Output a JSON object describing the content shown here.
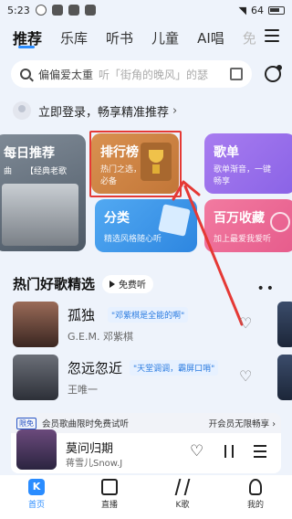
{
  "status": {
    "time": "5:23",
    "battery": "64"
  },
  "nav": {
    "tabs": [
      "推荐",
      "乐库",
      "听书",
      "儿童",
      "AI唱",
      "免"
    ],
    "active_index": 0
  },
  "search": {
    "term": "偏偏爱太重",
    "hint": "听「街角的晚风」的瑟"
  },
  "login": {
    "text": "立即登录，畅享精准推荐"
  },
  "cards": {
    "daily": {
      "title": "每日推荐",
      "tag1": "曲",
      "tag2": "【经典老歌"
    },
    "rank": {
      "title": "排行榜",
      "sub1": "热门之选，潮流",
      "sub2": "必备"
    },
    "singles": {
      "title": "歌单",
      "sub1": "歌单渐音，一键",
      "sub2": "畅享"
    },
    "category": {
      "title": "分类",
      "sub": "精选风格随心听"
    },
    "million": {
      "title": "百万收藏",
      "sub": "加上最爱我爱听"
    }
  },
  "section": {
    "title": "热门好歌精选",
    "play_label": "免费听"
  },
  "songs": [
    {
      "title": "孤独",
      "tag": "\"邓紫棋是全能的啊\"",
      "artist": "G.E.M. 邓紫棋"
    },
    {
      "title": "忽远忽近",
      "tag": "\"天堂调调，霸屏口哨\"",
      "artist": "王唯一"
    }
  ],
  "vip": {
    "badge": "限免",
    "left": "会员歌曲限时免费试听",
    "right": "开会员无限畅享 ›"
  },
  "player": {
    "title": "莫问归期",
    "artist": "蒋雪儿Snow.J"
  },
  "bottom_nav": [
    {
      "label": "首页",
      "active": true
    },
    {
      "label": "直播",
      "active": false
    },
    {
      "label": "K歌",
      "active": false
    },
    {
      "label": "我的",
      "active": false
    }
  ],
  "colors": {
    "accent": "#2a8cff",
    "highlight": "#e53935"
  }
}
